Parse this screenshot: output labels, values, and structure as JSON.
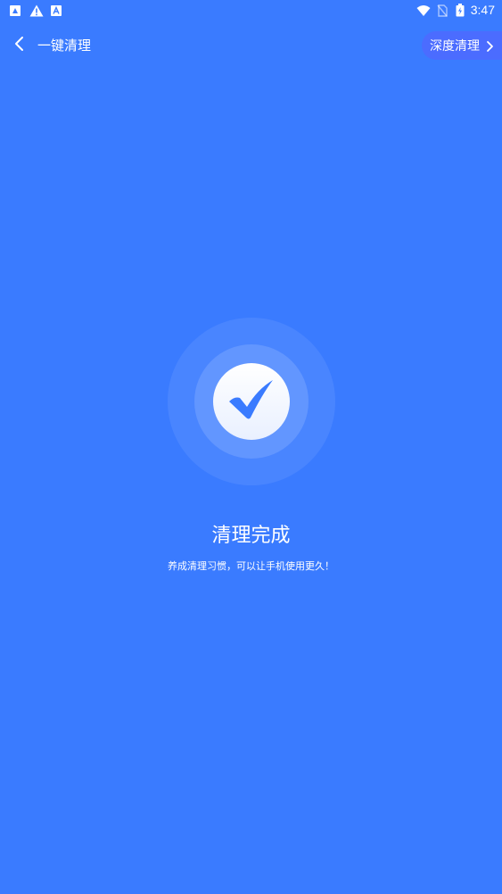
{
  "status_bar": {
    "time": "3:47",
    "left_icons": [
      "notification-icon",
      "warning-icon",
      "app-notification-icon"
    ],
    "right_icons": [
      "wifi-icon",
      "no-sim-icon",
      "battery-icon"
    ]
  },
  "app_bar": {
    "title": "一键清理",
    "back_icon": "chevron-left-icon",
    "action_label": "深度清理",
    "action_icon": "chevron-right-icon"
  },
  "result": {
    "icon": "check-icon",
    "title": "清理完成",
    "subtitle": "养成清理习惯，可以让手机使用更久！"
  },
  "colors": {
    "background": "#3a7bff",
    "action_pill": "#4b6cff",
    "check": "#3a7bff"
  }
}
